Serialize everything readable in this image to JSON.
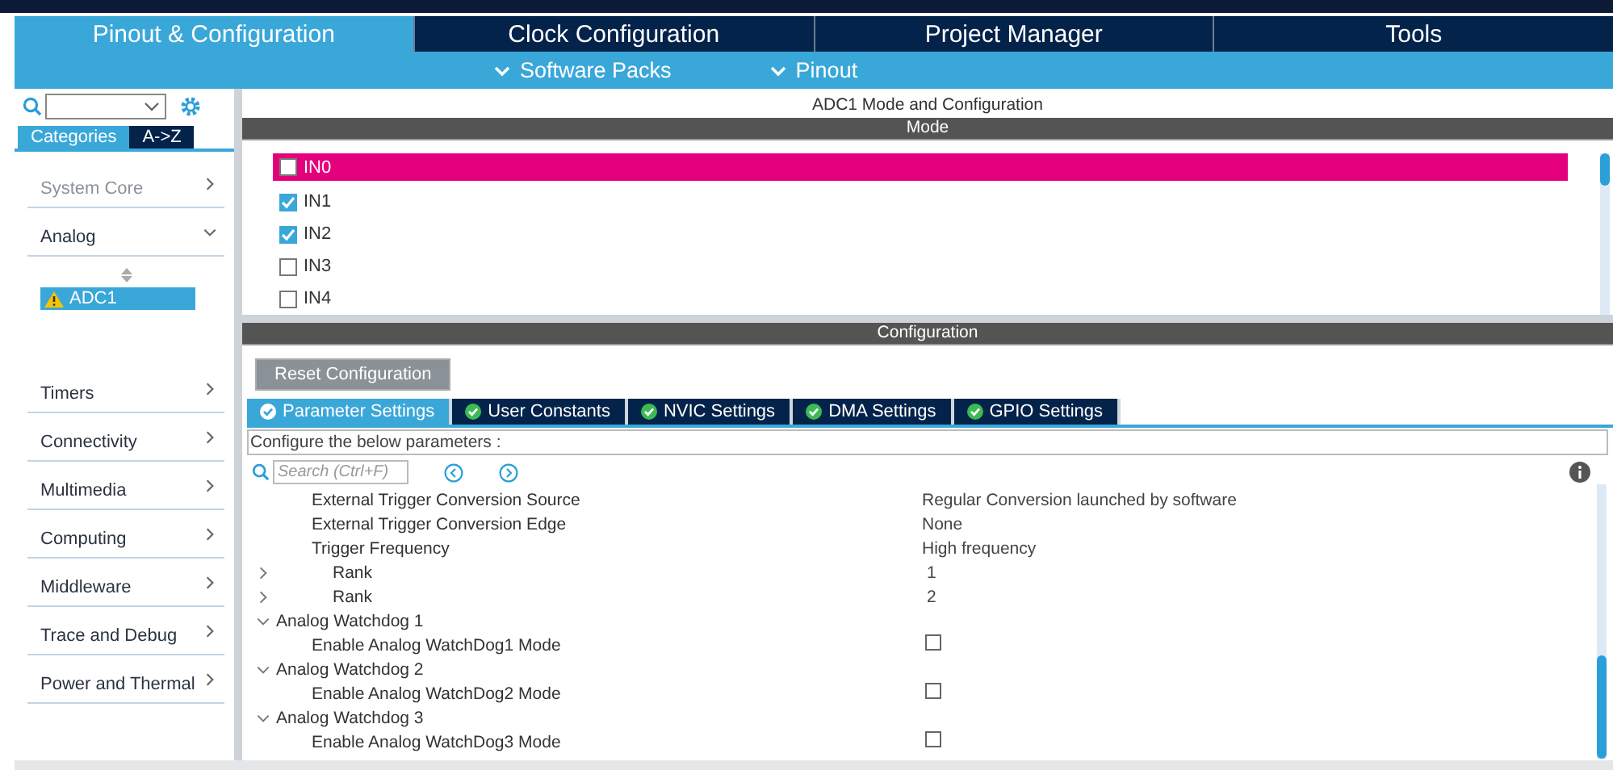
{
  "main_tabs": [
    {
      "label": "Pinout & Configuration",
      "selected": true
    },
    {
      "label": "Clock Configuration",
      "selected": false
    },
    {
      "label": "Project Manager",
      "selected": false
    },
    {
      "label": "Tools",
      "selected": false
    }
  ],
  "sub_menus": [
    {
      "label": "Software Packs"
    },
    {
      "label": "Pinout"
    }
  ],
  "sidebar": {
    "view_tabs": [
      {
        "label": "Categories",
        "selected": true
      },
      {
        "label": "A->Z",
        "selected": false
      }
    ],
    "categories": [
      {
        "label": "System Core",
        "expanded": false,
        "disabled": true
      },
      {
        "label": "Analog",
        "expanded": true,
        "disabled": false,
        "children": [
          {
            "label": "ADC1",
            "selected": true,
            "warning": true
          }
        ]
      },
      {
        "label": "Timers",
        "expanded": false,
        "disabled": false
      },
      {
        "label": "Connectivity",
        "expanded": false,
        "disabled": false
      },
      {
        "label": "Multimedia",
        "expanded": false,
        "disabled": false
      },
      {
        "label": "Computing",
        "expanded": false,
        "disabled": false
      },
      {
        "label": "Middleware",
        "expanded": false,
        "disabled": false
      },
      {
        "label": "Trace and Debug",
        "expanded": false,
        "disabled": false
      },
      {
        "label": "Power and Thermal",
        "expanded": false,
        "disabled": false
      }
    ]
  },
  "panel_title": "ADC1 Mode and Configuration",
  "mode": {
    "header": "Mode",
    "channels": [
      {
        "label": "IN0",
        "checked": false,
        "selected": true
      },
      {
        "label": "IN1",
        "checked": true,
        "selected": false
      },
      {
        "label": "IN2",
        "checked": true,
        "selected": false
      },
      {
        "label": "IN3",
        "checked": false,
        "selected": false
      },
      {
        "label": "IN4",
        "checked": false,
        "selected": false
      }
    ]
  },
  "configuration": {
    "header": "Configuration",
    "reset_button": "Reset Configuration",
    "tabs": [
      {
        "label": "Parameter Settings",
        "selected": true
      },
      {
        "label": "User Constants",
        "selected": false
      },
      {
        "label": "NVIC Settings",
        "selected": false
      },
      {
        "label": "DMA Settings",
        "selected": false
      },
      {
        "label": "GPIO Settings",
        "selected": false
      }
    ],
    "hint": "Configure the below parameters :",
    "search": {
      "placeholder": "Search (Ctrl+F)"
    },
    "parameters": [
      {
        "kind": "param",
        "label": "External Trigger Conversion Source",
        "value": "Regular Conversion launched by software"
      },
      {
        "kind": "param",
        "label": "External Trigger Conversion Edge",
        "value": "None"
      },
      {
        "kind": "param",
        "label": "Trigger Frequency",
        "value": "High frequency"
      },
      {
        "kind": "expandable",
        "expanded": false,
        "label": "Rank",
        "value": "1"
      },
      {
        "kind": "expandable",
        "expanded": false,
        "label": "Rank",
        "value": "2"
      },
      {
        "kind": "group",
        "expanded": true,
        "label": "Analog Watchdog 1"
      },
      {
        "kind": "checkbox",
        "label": "Enable Analog WatchDog1 Mode",
        "checked": false
      },
      {
        "kind": "group",
        "expanded": true,
        "label": "Analog Watchdog 2"
      },
      {
        "kind": "checkbox",
        "label": "Enable Analog WatchDog2 Mode",
        "checked": false
      },
      {
        "kind": "group",
        "expanded": true,
        "label": "Analog Watchdog 3"
      },
      {
        "kind": "checkbox",
        "label": "Enable Analog WatchDog3 Mode",
        "checked": false
      }
    ]
  }
}
